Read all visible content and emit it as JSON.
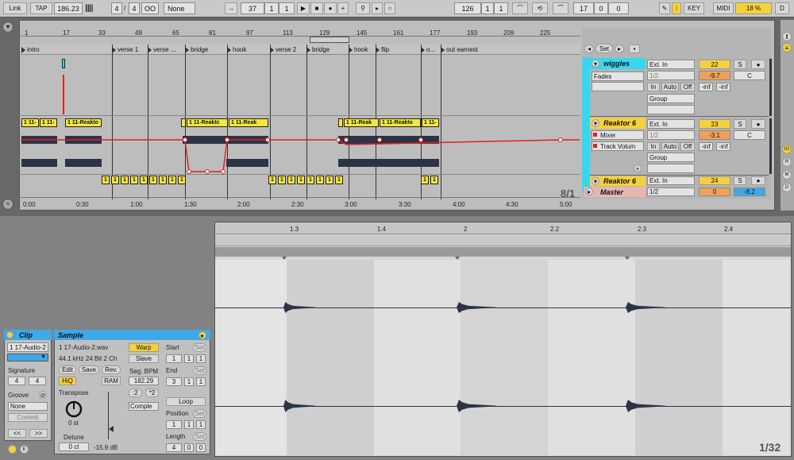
{
  "toolbar": {
    "link": "Link",
    "tap": "TAP",
    "tempo": "186.23",
    "sig_num": "4",
    "sig_den": "4",
    "metro": "OO",
    "quant": "None",
    "position": [
      "37",
      "1",
      "1"
    ],
    "loop_start": [
      "126",
      "1",
      "1"
    ],
    "loop_len": [
      "17",
      "0",
      "0"
    ],
    "key": "KEY",
    "midi": "MIDI",
    "cpu": "18 %",
    "d": "D"
  },
  "ruler": {
    "bars": [
      "1",
      "17",
      "33",
      "49",
      "65",
      "81",
      "97",
      "113",
      "129",
      "145",
      "161",
      "177",
      "193",
      "209",
      "225"
    ],
    "times": [
      "0:00",
      "0:30",
      "1:00",
      "1:30",
      "2:00",
      "2:30",
      "3:00",
      "3:30",
      "4:00",
      "4:30",
      "5:00"
    ],
    "zoom": "8/1"
  },
  "locators": [
    "intro",
    "verse 1",
    "verse ...",
    "bridge",
    "hook",
    "verse 2",
    "bridge",
    "hook",
    "flip",
    "o...",
    "out earnest"
  ],
  "clips": {
    "track2": [
      "1 11-",
      "1 11-",
      "1 11-Reakto",
      "1 11-Reaktc",
      "1 11-Reak",
      "1 11-Reak",
      "1 11-Reakto",
      "1 11-"
    ],
    "track3_short": "1 1"
  },
  "set_button": "Set",
  "tracks": [
    {
      "name": "wiggles",
      "input": "Ext. In",
      "channel": "1/2",
      "auto_label": "Fades",
      "monitor": [
        "In",
        "Auto",
        "Off"
      ],
      "group": "Group",
      "number": "22",
      "volume": "-9.7",
      "pan": "C",
      "peak": [
        "-inf",
        "-inf"
      ],
      "solo": "S"
    },
    {
      "name": "Reaktor 6",
      "input": "Ext. In",
      "channel": "1/2",
      "auto_label": "Mixer",
      "auto_label2": "Track Volum",
      "monitor": [
        "In",
        "Auto",
        "Off"
      ],
      "group": "Group",
      "number": "23",
      "volume": "-3.1",
      "pan": "C",
      "peak": [
        "-inf",
        "-inf"
      ],
      "solo": "S"
    },
    {
      "name": "Reaktor 6",
      "input": "Ext. In",
      "number": "24",
      "solo": "S"
    }
  ],
  "master": {
    "name": "Master",
    "channel": "1/2",
    "volume": "0",
    "peak": "-8.2"
  },
  "clip_view": {
    "clip_title": "Clip",
    "clip_name": "1 17-Audio-2",
    "signature_label": "Signature",
    "sig_num": "4",
    "sig_den": "4",
    "groove_label": "Groove",
    "groove": "None",
    "commit": "Commit",
    "nav": [
      "<<",
      ">>"
    ],
    "sample_title": "Sample",
    "file": "1 17-Audio-2.wav",
    "format": "44.1 kHz 24 Bit 2 Ch",
    "edit": "Edit",
    "save": "Save",
    "rev": "Rev.",
    "hiq": "HiQ",
    "ram": "RAM",
    "transpose_label": "Transpose",
    "transpose": "0 st",
    "detune_label": "Detune",
    "detune": "0 ct",
    "gain": "-15.9 dB",
    "warp": "Warp",
    "slave": "Slave",
    "seg_bpm_label": "Seg. BPM",
    "seg_bpm": "182.29",
    "half": ":2",
    "double": "*2",
    "mode": "Comple",
    "start_label": "Start",
    "start": [
      "1",
      "1",
      "1"
    ],
    "end_label": "End",
    "end": [
      "3",
      "1",
      "1"
    ],
    "loop": "Loop",
    "position_label": "Position",
    "position": [
      "1",
      "1",
      "1"
    ],
    "length_label": "Length",
    "length": [
      "4",
      "0",
      "0"
    ],
    "set": "Set"
  },
  "sample_ruler": [
    "1.3",
    "1.4",
    "2",
    "2.2",
    "2.3",
    "2.4"
  ],
  "sample_zoom": "1/32"
}
